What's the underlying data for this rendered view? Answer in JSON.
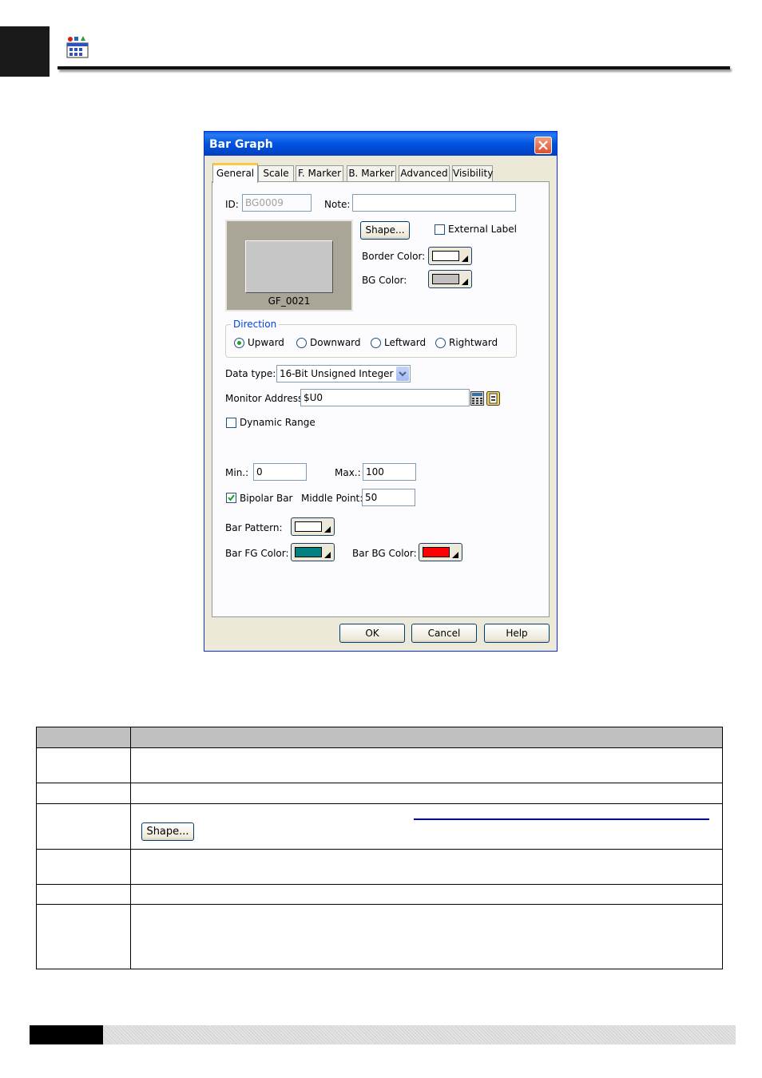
{
  "dialog": {
    "title": "Bar Graph",
    "tabs": [
      "General",
      "Scale",
      "F. Marker",
      "B. Marker",
      "Advanced",
      "Visibility"
    ],
    "id_label": "ID:",
    "id_value": "BG0009",
    "note_label": "Note:",
    "note_value": "",
    "shape_button": "Shape...",
    "external_label": "External Label",
    "external_label_checked": false,
    "shape_preview_caption": "GF_0021",
    "border_color_label": "Border Color:",
    "border_color": "#ffffff",
    "bg_color_label": "BG Color:",
    "bg_color": "#c0c0c0",
    "direction_label": "Direction",
    "directions": [
      "Upward",
      "Downward",
      "Leftward",
      "Rightward"
    ],
    "direction_selected": "Upward",
    "data_type_label": "Data type:",
    "data_type_value": "16-Bit Unsigned Integer",
    "monitor_address_label": "Monitor Address:",
    "monitor_address_value": "$U0",
    "dynamic_range_label": "Dynamic Range",
    "dynamic_range_checked": false,
    "min_label": "Min.:",
    "min_value": "0",
    "max_label": "Max.:",
    "max_value": "100",
    "bipolar_label": "Bipolar Bar",
    "bipolar_checked": true,
    "middle_point_label": "Middle Point:",
    "middle_point_value": "50",
    "bar_pattern_label": "Bar Pattern:",
    "bar_pattern_color": "#ffffff",
    "bar_fg_label": "Bar FG Color:",
    "bar_fg_color": "#008080",
    "bar_bg_label": "Bar BG Color:",
    "bar_bg_color": "#ff0000",
    "ok_button": "OK",
    "cancel_button": "Cancel",
    "help_button": "Help"
  },
  "table": {
    "shape_button": "Shape..."
  },
  "colors": {
    "title_bar": "#0053e1",
    "accent_tab": "#ffc83c",
    "table_header": "#c0c0c0",
    "link": "#0000cc"
  },
  "icons": [
    "object-tool-icon",
    "close-icon",
    "dropdown-arrow-icon",
    "calculator-icon",
    "address-book-icon",
    "checkmark-icon"
  ]
}
